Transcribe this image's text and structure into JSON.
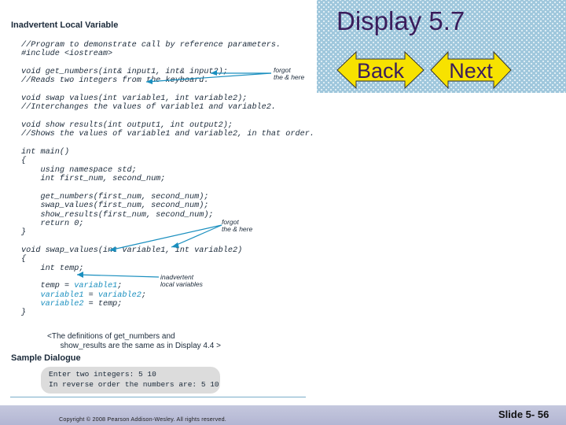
{
  "header": {
    "title": "Display 5.7",
    "back_label": "Back",
    "next_label": "Next"
  },
  "figure": {
    "heading": "Inadvertent Local Variable",
    "code_lines": [
      [
        {
          "t": "//Program to demonstrate call by reference parameters."
        }
      ],
      [
        {
          "t": "#include <iostream>"
        }
      ],
      [
        {
          "t": ""
        }
      ],
      [
        {
          "t": "void get_numbers(int& input1, int& input2);"
        }
      ],
      [
        {
          "t": "//Reads two integers from the keyboard."
        }
      ],
      [
        {
          "t": ""
        }
      ],
      [
        {
          "t": "void swap values(int variable1, int variable2);"
        }
      ],
      [
        {
          "t": "//Interchanges the values of variable1 and variable2."
        }
      ],
      [
        {
          "t": ""
        }
      ],
      [
        {
          "t": "void show results(int output1, int output2);"
        }
      ],
      [
        {
          "t": "//Shows the values of variable1 and variable2, in that order."
        }
      ],
      [
        {
          "t": ""
        }
      ],
      [
        {
          "t": "int main()"
        }
      ],
      [
        {
          "t": "{"
        }
      ],
      [
        {
          "t": "    using namespace std;"
        }
      ],
      [
        {
          "t": "    int first_num, second_num;"
        }
      ],
      [
        {
          "t": ""
        }
      ],
      [
        {
          "t": "    get_numbers(first_num, second_num);"
        }
      ],
      [
        {
          "t": "    swap_values(first_num, second_num);"
        }
      ],
      [
        {
          "t": "    show_results(first_num, second_num);"
        }
      ],
      [
        {
          "t": "    return 0;"
        }
      ],
      [
        {
          "t": "}"
        }
      ],
      [
        {
          "t": ""
        }
      ],
      [
        {
          "t": "void swap_values(int variable1, int variable2)"
        }
      ],
      [
        {
          "t": "{"
        }
      ],
      [
        {
          "t": "    int temp;"
        }
      ],
      [
        {
          "t": ""
        }
      ],
      [
        {
          "t": "    temp = "
        },
        {
          "t": "variable1",
          "hl": true
        },
        {
          "t": ";"
        }
      ],
      [
        {
          "t": "    "
        },
        {
          "t": "variable1",
          "hl": true
        },
        {
          "t": " = "
        },
        {
          "t": "variable2",
          "hl": true
        },
        {
          "t": ";"
        }
      ],
      [
        {
          "t": "    "
        },
        {
          "t": "variable2",
          "hl": true
        },
        {
          "t": " = temp;"
        }
      ],
      [
        {
          "t": "}"
        }
      ]
    ],
    "annotations": {
      "forgot_1": "forgot\nthe & here",
      "forgot_2": "forgot\nthe & here",
      "inadvertent": "inadvertent\nlocal variables"
    },
    "definitions_note": "<The definitions of get_numbers and\n      show_results are the same as in Display 4.4 >",
    "sample_heading": "Sample Dialogue",
    "dialogue": "Enter two integers: 5 10\nIn reverse order the numbers are: 5 10"
  },
  "footer": {
    "copyright": "Copyright © 2008 Pearson Addison-Wesley.  All rights reserved.",
    "slide_number": "Slide 5- 56"
  },
  "colors": {
    "title": "#3a1d5c",
    "button_fill": "#f7e200",
    "highlight": "#1a8fbf",
    "footer_bar": "#bcbfd8"
  }
}
